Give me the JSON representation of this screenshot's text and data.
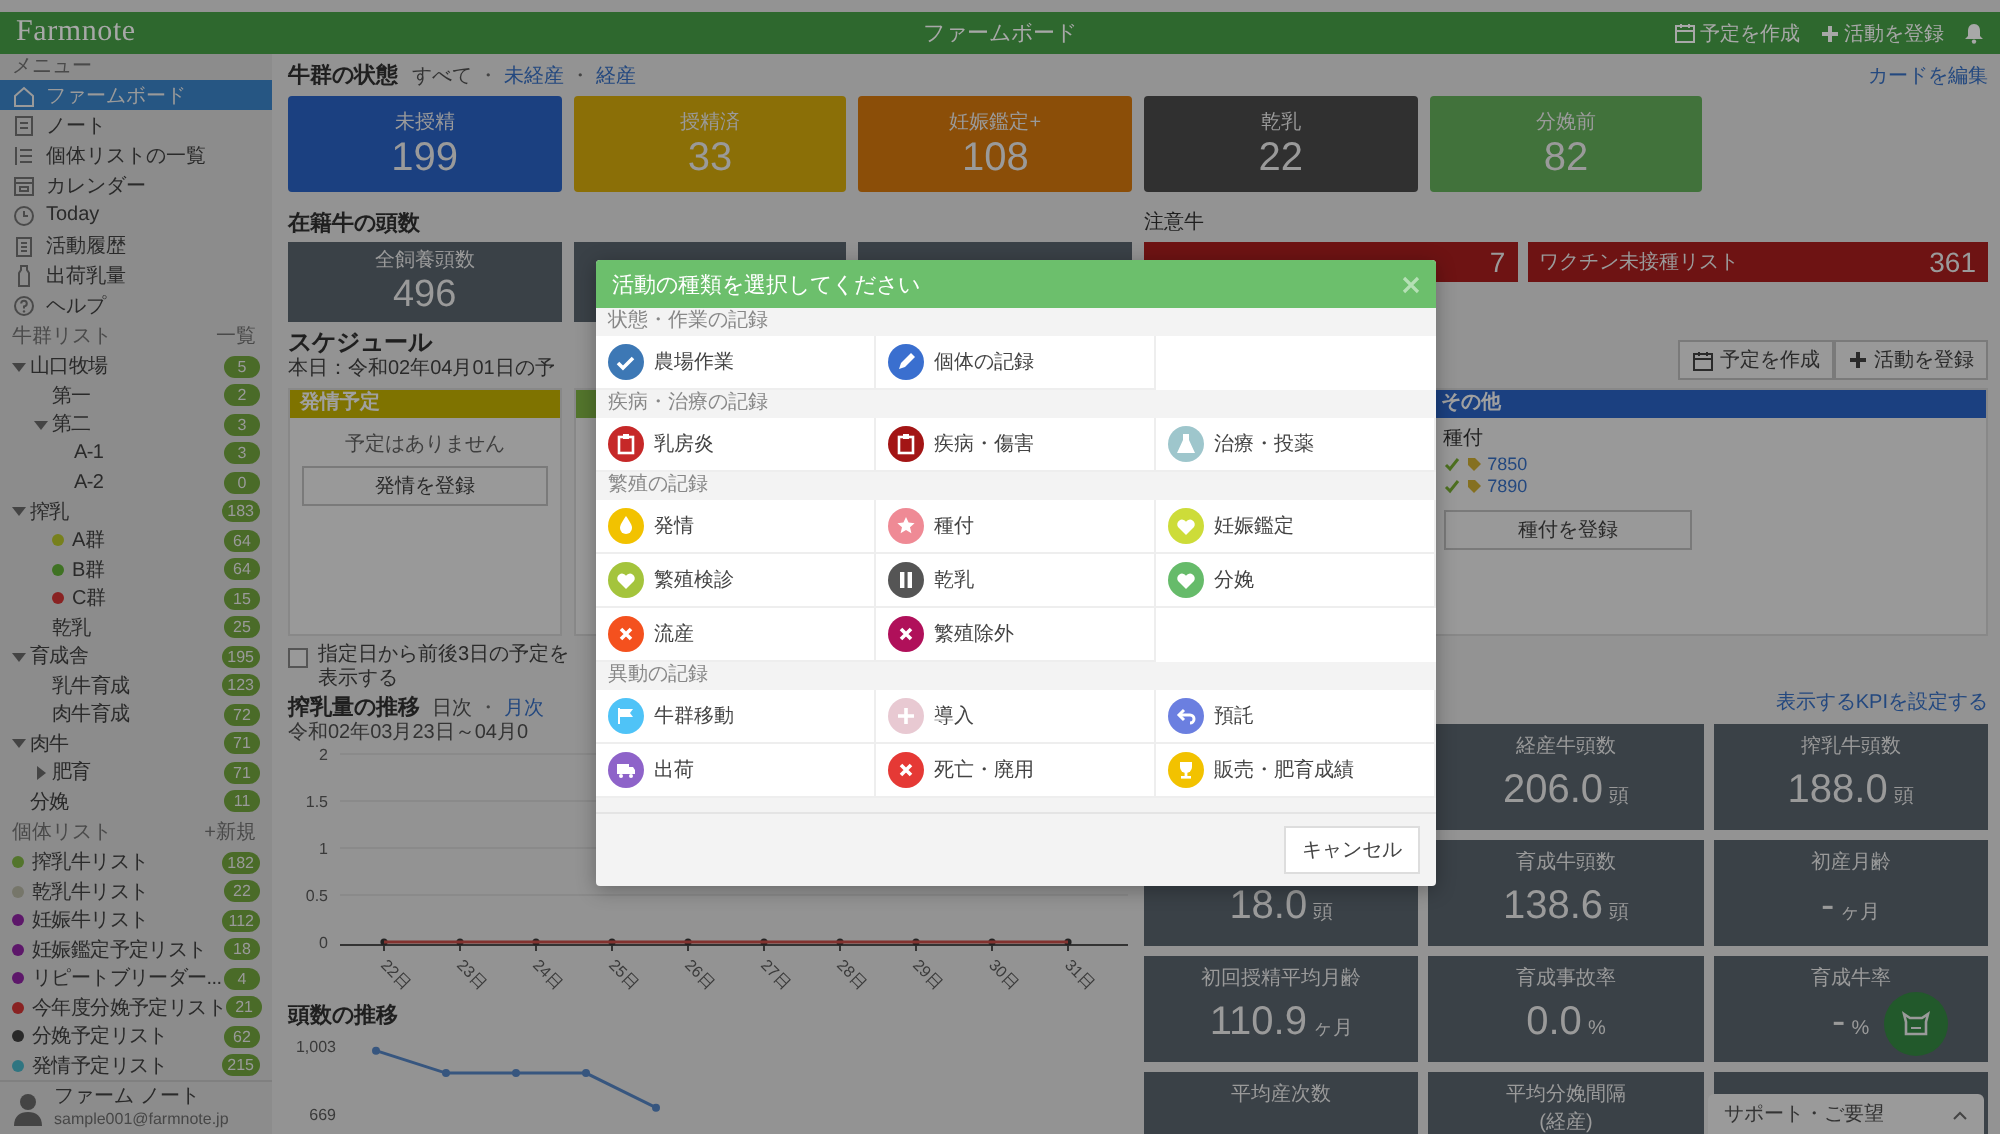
{
  "app": {
    "logo": "Farmnote",
    "title": "ファームボード",
    "actions": [
      {
        "kind": "calendar",
        "label": "予定を作成"
      },
      {
        "kind": "add",
        "label": "活動を登録"
      }
    ]
  },
  "sidebar": {
    "menu_label": "メニュー",
    "menu": [
      {
        "label": "ファームボード",
        "selected": true
      },
      {
        "label": "ノート",
        "selected": false
      },
      {
        "label": "個体リストの一覧",
        "selected": false
      },
      {
        "label": "カレンダー",
        "selected": false
      },
      {
        "label": "Today",
        "selected": false
      },
      {
        "label": "活動履歴",
        "selected": false
      },
      {
        "label": "出荷乳量",
        "selected": false
      },
      {
        "label": "ヘルプ",
        "selected": false
      }
    ],
    "herd_label": "牛群リスト",
    "herd_link": "一覧",
    "herds": [
      {
        "label": "山口牧場",
        "count": "5",
        "expanded": true,
        "children": [
          {
            "label": "第一",
            "count": "2"
          },
          {
            "label": "第二",
            "count": "3",
            "expanded": true,
            "children": [
              {
                "label": "A-1",
                "count": "3"
              },
              {
                "label": "A-2",
                "count": "0"
              }
            ]
          }
        ]
      },
      {
        "label": "搾乳",
        "count": "183",
        "expanded": true,
        "children": [
          {
            "label": "A群",
            "count": "64",
            "color": "#77801c"
          },
          {
            "label": "B群",
            "count": "64",
            "color": "#3f7223"
          },
          {
            "label": "C群",
            "count": "15",
            "color": "#892222"
          },
          {
            "label": "乾乳",
            "count": "25"
          }
        ]
      },
      {
        "label": "育成舎",
        "count": "195",
        "expanded": true,
        "children": [
          {
            "label": "乳牛育成",
            "count": "123"
          },
          {
            "label": "肉牛育成",
            "count": "72"
          }
        ]
      },
      {
        "label": "肉牛",
        "count": "71",
        "expanded": true,
        "children": [
          {
            "label": "肥育",
            "count": "71",
            "expanded": false
          }
        ]
      },
      {
        "label": "分娩",
        "count": "11"
      }
    ],
    "list_label": "個体リスト",
    "list_link": "+新規",
    "lists": [
      {
        "label": "搾乳牛リスト",
        "count": "182",
        "color": "#53752c"
      },
      {
        "label": "乾乳牛リスト",
        "count": "22",
        "color": "#76766a"
      },
      {
        "label": "妊娠牛リスト",
        "count": "112",
        "color": "#5d176a"
      },
      {
        "label": "妊娠鑑定予定リスト",
        "count": "18",
        "color": "#5d176a"
      },
      {
        "label": "リピートブリーダー...",
        "count": "4",
        "color": "#5d176a"
      },
      {
        "label": "今年度分娩予定リスト",
        "count": "21",
        "color": "#892222"
      },
      {
        "label": "分娩予定リスト",
        "count": "62",
        "color": "#292929"
      },
      {
        "label": "発情予定リスト",
        "count": "215",
        "color": "#2f7581"
      }
    ],
    "user": {
      "name": "ファーム ノート",
      "email": "sample001@farmnote.jp"
    }
  },
  "herd_status": {
    "title": "牛群の状態",
    "separator": "・",
    "filters": [
      {
        "label": "すべて",
        "selected": true
      },
      {
        "label": "未経産",
        "selected": false
      },
      {
        "label": "経産",
        "selected": false
      }
    ],
    "edit_link": "カードを編集",
    "cards": [
      {
        "label": "未授精",
        "value": "199",
        "color": "#1b4080"
      },
      {
        "label": "授精済",
        "value": "33",
        "color": "#8b6f07"
      },
      {
        "label": "妊娠鑑定+",
        "value": "108",
        "color": "#8b4e08"
      },
      {
        "label": "乾乳",
        "value": "22",
        "color": "#303030"
      },
      {
        "label": "分娩前",
        "value": "82",
        "color": "#41723b"
      }
    ]
  },
  "headcount": {
    "title": "在籍牛の頭数",
    "cards": [
      {
        "label": "全飼養頭数",
        "value": "496"
      }
    ]
  },
  "alerts": {
    "title": "注意牛",
    "items": [
      {
        "value": "7"
      },
      {
        "label": "ワクチン未接種リスト",
        "value": "361"
      }
    ]
  },
  "schedule": {
    "title": "スケジュール",
    "date": "本日：令和02年04月01日の予",
    "actions": [
      {
        "kind": "calendar",
        "label": "予定を作成"
      },
      {
        "kind": "add",
        "label": "活動を登録"
      }
    ],
    "columns": [
      {
        "kind": "list",
        "title": "発情予定",
        "color": "#7f7300",
        "empty": "予定はありません",
        "button": "発情を登録"
      },
      {
        "kind": "list",
        "color": "#53752c"
      },
      {
        "kind": "other",
        "title": "その他",
        "color": "#1b4080",
        "entry": "種付",
        "cows": [
          "7850",
          "7890"
        ],
        "button": "種付を登録"
      }
    ]
  },
  "show_nearby": {
    "label": "指定日から前後3日の予定を表示する",
    "checked": false
  },
  "milk": {
    "title": "搾乳量の推移",
    "separator": "・",
    "modes": [
      {
        "label": "日次",
        "selected": true
      },
      {
        "label": "月次",
        "selected": false
      }
    ],
    "range": "令和02年03月23日～04月0",
    "chart_data": {
      "type": "line",
      "grid": true,
      "categories": [
        "22日",
        "23日",
        "24日",
        "25日",
        "26日",
        "27日",
        "28日",
        "29日",
        "30日",
        "31日"
      ],
      "ylim": [
        0,
        2
      ],
      "yticks": [
        0,
        {
          "value": 0.5,
          "label": "0.5"
        },
        1,
        {
          "value": 1.5,
          "label": "1.5"
        },
        2
      ],
      "series": [
        {
          "color": "#82322f",
          "marker": true,
          "values": [
            0,
            0,
            0,
            0,
            0,
            0,
            0,
            0,
            0,
            0
          ]
        }
      ]
    }
  },
  "herd_trend": {
    "title": "頭数の推移",
    "chart_data": {
      "type": "line",
      "ylim": [
        669,
        1003
      ],
      "yticks": [
        {
          "value": 669,
          "label": "669"
        },
        {
          "value": 1003,
          "label": "1,003"
        }
      ],
      "series": [
        {
          "color": "#37567f",
          "marker": true,
          "values": [
            980,
            870,
            870,
            870,
            700
          ]
        }
      ]
    }
  },
  "kpi": {
    "link": "表示するKPIを設定する",
    "cards": [
      {
        "kind": "metric",
        "label": "経産牛頭数",
        "value": "206.0",
        "unit": "頭"
      },
      {
        "kind": "metric",
        "label": "搾乳牛頭数",
        "value": "188.0",
        "unit": "頭"
      },
      {
        "kind": "metric",
        "value": "18.0",
        "unit": "頭"
      },
      {
        "kind": "metric",
        "label": "育成牛頭数",
        "value": "138.6",
        "unit": "頭"
      },
      {
        "kind": "metric",
        "label": "初産月齢",
        "value": "-",
        "unit": "ヶ月"
      },
      {
        "kind": "metric",
        "label": "初回授精平均月齢",
        "value": "110.9",
        "unit": "ヶ月"
      },
      {
        "kind": "metric",
        "label": "育成事故率",
        "value": "0.0",
        "unit": "%"
      },
      {
        "kind": "metric",
        "label": "育成牛率",
        "value": "-",
        "unit": "%"
      },
      {
        "kind": "metric",
        "label": "平均産次数"
      },
      {
        "kind": "metric",
        "label": "平均分娩間隔",
        "note": "(経産)"
      },
      {
        "kind": "blank"
      }
    ]
  },
  "support": {
    "label": "サポート・ご要望"
  },
  "modal": {
    "title": "活動の種類を選択してください",
    "cancel": "キャンセル",
    "sections": [
      {
        "label": "状態・作業の記録",
        "items": [
          {
            "label": "農場作業",
            "color": "#3d78b5"
          },
          {
            "label": "個体の記録",
            "color": "#3a6fcf"
          }
        ]
      },
      {
        "label": "疾病・治療の記録",
        "items": [
          {
            "label": "乳房炎",
            "color": "#c62828"
          },
          {
            "label": "疾病・傷害",
            "color": "#a31515"
          },
          {
            "label": "治療・投薬",
            "color": "#9ec6cc"
          }
        ]
      },
      {
        "label": "繁殖の記録",
        "items": [
          {
            "label": "発情",
            "color": "#f2c200"
          },
          {
            "label": "種付",
            "color": "#ef8a95"
          },
          {
            "label": "妊娠鑑定",
            "color": "#cddc39"
          },
          {
            "label": "繁殖検診",
            "color": "#a4c43c"
          },
          {
            "label": "乾乳",
            "color": "#555555"
          },
          {
            "label": "分娩",
            "color": "#66bb6a"
          },
          {
            "label": "流産",
            "color": "#f4511e"
          },
          {
            "label": "繁殖除外",
            "color": "#b0105a"
          }
        ]
      },
      {
        "label": "異動の記録",
        "items": [
          {
            "label": "牛群移動",
            "color": "#4fc3f7"
          },
          {
            "label": "導入",
            "color": "#e8c9d2"
          },
          {
            "label": "預託",
            "color": "#6b7fe0"
          },
          {
            "label": "出荷",
            "color": "#8e63c9"
          },
          {
            "label": "死亡・廃用",
            "color": "#e53935"
          },
          {
            "label": "販売・肥育成績",
            "color": "#f2c200"
          }
        ]
      }
    ]
  }
}
